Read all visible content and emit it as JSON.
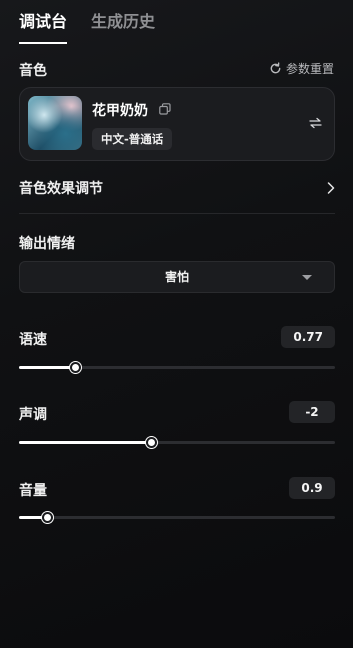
{
  "tabs": [
    {
      "label": "调试台",
      "active": true
    },
    {
      "label": "生成历史",
      "active": false
    }
  ],
  "voice": {
    "section_title": "音色",
    "reset_label": "参数重置",
    "name": "花甲奶奶",
    "language": "中文-普通话"
  },
  "effect": {
    "label": "音色效果调节"
  },
  "emotion": {
    "section_title": "输出情绪",
    "selected": "害怕"
  },
  "sliders": [
    {
      "label": "语速",
      "value": "0.77",
      "fraction": 0.18
    },
    {
      "label": "声调",
      "value": "-2",
      "fraction": 0.42
    },
    {
      "label": "音量",
      "value": "0.9",
      "fraction": 0.09
    }
  ],
  "colors": {
    "accent": "#ffffff",
    "background": "#111214",
    "card": "#1b1c1f"
  },
  "icons": {
    "reset": "refresh-icon",
    "copy": "copy-icon",
    "swap": "swap-icon",
    "chevron": "chevron-right-icon",
    "dropdown": "caret-down-icon"
  }
}
